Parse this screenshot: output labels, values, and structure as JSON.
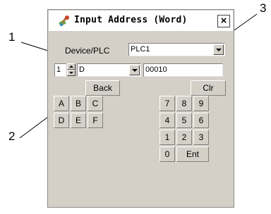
{
  "window": {
    "title": "Input Address (Word)",
    "close": "×"
  },
  "device": {
    "label": "Device/PLC",
    "value": "PLC1"
  },
  "address": {
    "station": "1",
    "type": "D",
    "number": "00010"
  },
  "keys": {
    "back": "Back",
    "clr": "Clr",
    "a": "A",
    "b": "B",
    "c": "C",
    "d": "D",
    "e": "E",
    "f": "F",
    "k7": "7",
    "k8": "8",
    "k9": "9",
    "k4": "4",
    "k5": "5",
    "k6": "6",
    "k1": "1",
    "k2": "2",
    "k3": "3",
    "k0": "0",
    "ent": "Ent"
  },
  "callouts": [
    "1",
    "2",
    "3"
  ],
  "colors": {
    "dialog_bg": "#d4d0c8",
    "title_bg": "#ffffff",
    "field_bg": "#ffffff"
  }
}
